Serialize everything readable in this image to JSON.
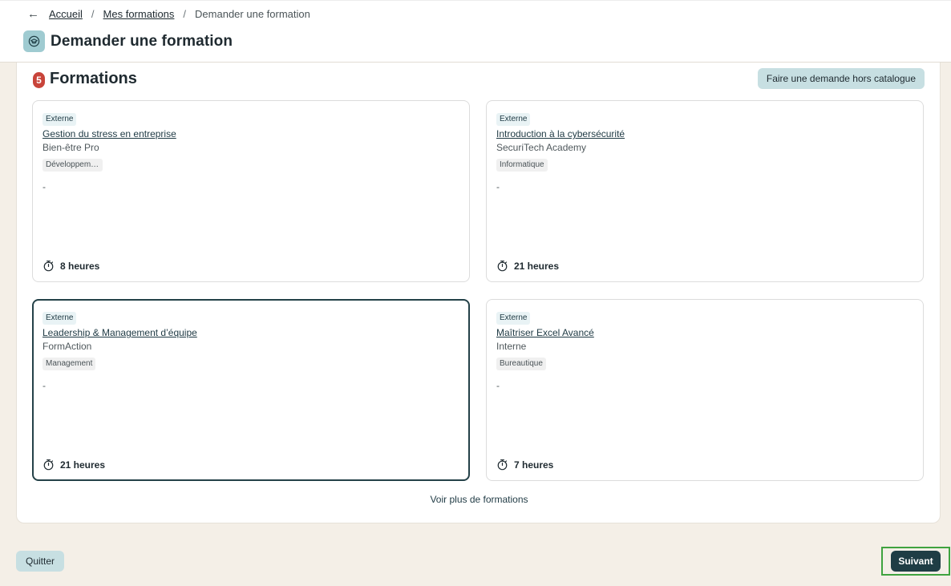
{
  "breadcrumb": {
    "back_icon": "arrow-left-icon",
    "items": [
      "Accueil",
      "Mes formations"
    ],
    "separator": "/",
    "current": "Demander une formation"
  },
  "header": {
    "icon": "graduation-cap-icon",
    "title": "Demander une formation"
  },
  "section": {
    "count": "5",
    "title": "Formations",
    "hors_catalogue_label": "Faire une demande hors catalogue"
  },
  "cards": [
    {
      "type": "Externe",
      "title": "Gestion du stress en entreprise",
      "provider": "Bien-être Pro",
      "category": "Développement personnel",
      "description": "-",
      "duration": "8 heures",
      "selected": false
    },
    {
      "type": "Externe",
      "title": "Introduction à la cybersécurité",
      "provider": "SecuriTech Academy",
      "category": "Informatique",
      "description": "-",
      "duration": "21 heures",
      "selected": false
    },
    {
      "type": "Externe",
      "title": "Leadership & Management d’équipe",
      "provider": "FormAction",
      "category": "Management",
      "description": "-",
      "duration": "21 heures",
      "selected": true
    },
    {
      "type": "Externe",
      "title": "Maîtriser Excel Avancé",
      "provider": "Interne",
      "category": "Bureautique",
      "description": "-",
      "duration": "7 heures",
      "selected": false
    }
  ],
  "voir_plus_label": "Voir plus de formations",
  "footer": {
    "quit_label": "Quitter",
    "next_label": "Suivant"
  },
  "colors": {
    "background": "#f4efe7",
    "accent_light": "#c7dfe2",
    "accent_dark": "#1f3d45",
    "badge_red": "#c8443a",
    "focus_green": "#3fa33f"
  }
}
